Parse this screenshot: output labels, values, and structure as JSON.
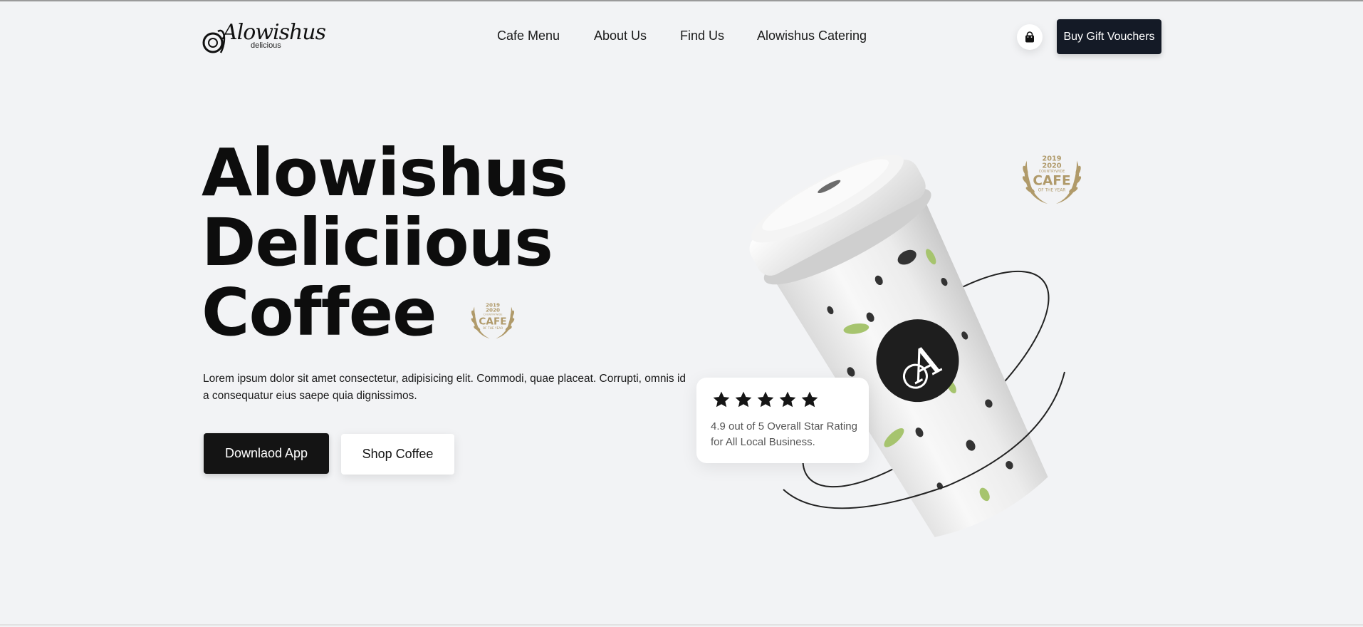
{
  "brand": {
    "logo_text": "Alowishus",
    "logo_subtext": "delicious"
  },
  "nav": {
    "links": [
      {
        "label": "Cafe Menu"
      },
      {
        "label": "About Us"
      },
      {
        "label": "Find Us"
      },
      {
        "label": "Alowishus Catering"
      }
    ],
    "cart_icon": "shopping-bag-icon",
    "gift_button_label": "Buy Gift Vouchers"
  },
  "hero": {
    "title_lines": [
      "Alowishus",
      "Deliciious",
      "Coffee"
    ],
    "description": "Lorem ipsum dolor sit amet consectetur, adipisicing elit. Commodi, quae placeat. Corrupti, omnis id a consequatur eius saepe quia dignissimos.",
    "primary_button": "Downlaod App",
    "secondary_button": "Shop Coffee"
  },
  "award": {
    "years": "2019 2020",
    "small_text": "COUNTRYWIDE",
    "main_text": "CAFE",
    "sub_text": "OF THE YEAR"
  },
  "rating": {
    "stars": 5,
    "text": "4.9 out of 5 Overall Star Rating for All Local Business."
  },
  "colors": {
    "background": "#f2f3f5",
    "dark_button": "#141a26",
    "gold": "#b09a6a",
    "leaf_green": "#a6c46e"
  }
}
